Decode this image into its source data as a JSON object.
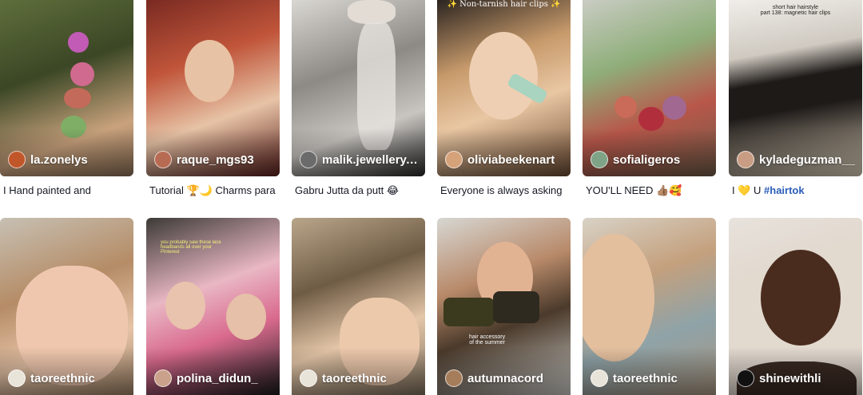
{
  "row1": [
    {
      "username": "la.zonelys",
      "caption": "I Hand painted and",
      "hashtag": "",
      "avatar_color": "#c0562a",
      "bg": "linear-gradient(160deg,#5f6e3c 0%,#3b4725 40%,#c9a27d 75%,#8b6f55 100%)"
    },
    {
      "username": "raque_mgs93",
      "caption": "Tutorial 🏆🌙 Charms para",
      "hashtag": "",
      "avatar_color": "#b86b53",
      "bg": "linear-gradient(160deg,#7a2a22 0%,#c0553a 35%,#e7c3a6 65%,#5a1f1c 100%)"
    },
    {
      "username": "malik.jewellery....",
      "caption": "Gabru Jutta da putt 😂",
      "hashtag": "",
      "avatar_color": "#6b6b6b",
      "bg": "linear-gradient(160deg,#d9d7d2 0%,#8d8a86 40%,#c8c5c0 70%,#2a2a2a 100%)"
    },
    {
      "username": "oliviabeekenart",
      "caption": "Everyone is always asking",
      "hashtag": "",
      "avatar_color": "#d6a27a",
      "bg": "linear-gradient(160deg,#2b2420 0%,#c79a6b 35%,#e9c7a3 60%,#6b4a32 100%)"
    },
    {
      "username": "sofialigeros",
      "caption": "YOU'LL NEED 👍🏽🥰",
      "hashtag": "",
      "avatar_color": "#7fa386",
      "bg": "linear-gradient(160deg,#c9ccc3 0%,#8fae7a 35%,#b8574a 65%,#6e5a46 100%)"
    },
    {
      "username": "kyladeguzman__",
      "caption": "I 💛 U ",
      "hashtag": "#hairtok",
      "avatar_color": "#c99d83",
      "bg": "linear-gradient(160deg,#f0eeea 0%,#cfc9c0 30%,#1e1a18 55%,#d9cdb8 100%)"
    }
  ],
  "row2": [
    {
      "username": "taoreethnic",
      "avatar_color": "#e9e4da",
      "bg": "linear-gradient(160deg,#c7c0b3 0%,#b58c66 40%,#e6c3a7 70%,#9a7f63 100%)"
    },
    {
      "username": "polina_didun_",
      "avatar_color": "#caa18a",
      "bg": "linear-gradient(160deg,#3c3a36 0%,#e9b7c4 40%,#d96a8e 65%,#1b1b1b 100%)"
    },
    {
      "username": "taoreethnic",
      "avatar_color": "#e9e4da",
      "bg": "linear-gradient(160deg,#b9a68a 0%,#6f5c45 35%,#e4c6a8 65%,#7b6d5a 100%)"
    },
    {
      "username": "autumnacord",
      "avatar_color": "#a67d5b",
      "bg": "linear-gradient(160deg,#d7d7d3 0%,#b88a6a 35%,#4b3a2b 60%,#c9c9c5 100%)"
    },
    {
      "username": "taoreethnic",
      "avatar_color": "#e9e4da",
      "bg": "linear-gradient(160deg,#d8d2c6 0%,#c4a07d 35%,#8fa3a8 65%,#a89580 100%)"
    },
    {
      "username": "shinewithli",
      "avatar_color": "#111111",
      "bg": "linear-gradient(160deg,#e7e2dc 0%,#5a3a2b 35%,#3a2418 60%,#e2d9cf 100%)"
    }
  ],
  "overlays": {
    "card4_top": "✨ Non-tarnish hair clips ✨",
    "card6_top": "short hair hairstyle\npart 138: magnetic hair clips",
    "card8_text": "you probably saw these lace\nheadbands all over your\nPinterest",
    "card10_text": "hair accessory\nof the summer"
  }
}
